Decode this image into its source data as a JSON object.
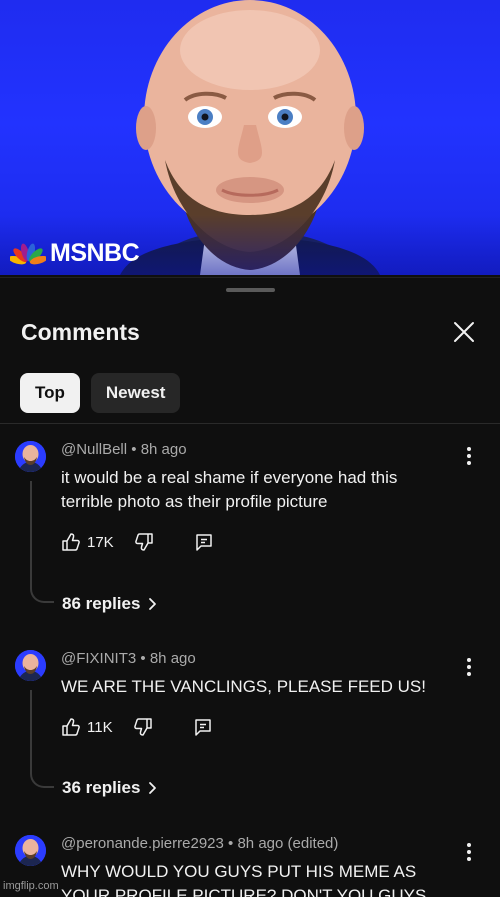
{
  "video": {
    "channel_logo_text": "MSNBC",
    "background_color": "#2233ff",
    "peacock_colors": [
      "#f7b500",
      "#e8361f",
      "#a11d8e",
      "#2b63d9",
      "#2aa84a",
      "#f07f1a"
    ]
  },
  "comments_sheet": {
    "title": "Comments",
    "close_icon": "close-icon",
    "filters": [
      {
        "label": "Top",
        "selected": true
      },
      {
        "label": "Newest",
        "selected": false
      }
    ]
  },
  "comments": [
    {
      "author": "@NullBell",
      "time": "8h ago",
      "edited": "",
      "lines": [
        "it would be a real shame if everyone had this",
        "terrible photo as their profile picture"
      ],
      "likes": "17K",
      "replies": "86 replies"
    },
    {
      "author": "@FIXINIT3",
      "time": "8h ago",
      "edited": "",
      "lines": [
        "WE ARE THE VANCLINGS, PLEASE FEED US!"
      ],
      "likes": "11K",
      "replies": "36 replies"
    },
    {
      "author": "@peronande.pierre2923",
      "time": "8h ago",
      "edited": "(edited)",
      "lines": [
        "WHY WOULD YOU GUYS PUT HIS MEME AS",
        "YOUR PROFILE PICTURE?  DON'T YOU GUYS"
      ]
    }
  ],
  "meta_separator": "•",
  "watermark": "imgflip.com"
}
